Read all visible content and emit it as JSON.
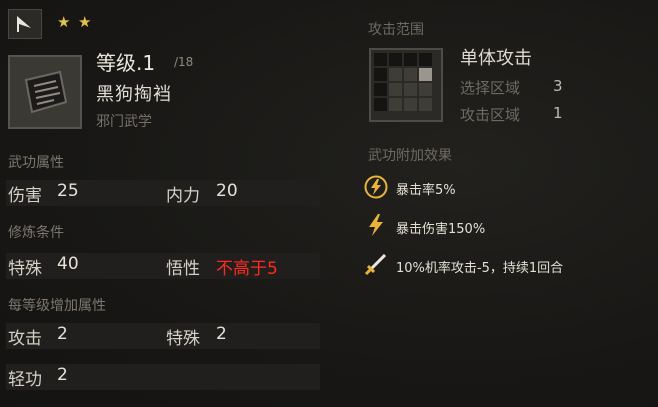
{
  "header": {
    "stars": [
      "★",
      "★"
    ]
  },
  "skill": {
    "level_label": "等级.1",
    "level_max": "/18",
    "name": "黑狗掏裆",
    "school": "邪门武学"
  },
  "attributes": {
    "title": "武功属性",
    "damage_label": "伤害",
    "damage_value": "25",
    "internal_label": "内力",
    "internal_value": "20"
  },
  "requirements": {
    "title": "修炼条件",
    "special_label": "特殊",
    "special_value": "40",
    "comprehension_label": "悟性",
    "comprehension_value": "不高于5"
  },
  "per_level": {
    "title": "每等级增加属性",
    "attack_label": "攻击",
    "attack_value": "2",
    "special_label": "特殊",
    "special_value": "2",
    "agility_label": "轻功",
    "agility_value": "2"
  },
  "attack_range": {
    "title": "攻击范围",
    "target_type": "单体攻击",
    "select_area_label": "选择区域",
    "select_area_value": "3",
    "attack_area_label": "攻击区域",
    "attack_area_value": "1"
  },
  "effects": {
    "title": "武功附加效果",
    "items": [
      {
        "icon": "lightning-circle-icon",
        "text": "暴击率5%"
      },
      {
        "icon": "lightning-icon",
        "text": "暴击伤害150%"
      },
      {
        "icon": "sword-icon",
        "text": "10%机率攻击-5，持续1回合"
      }
    ]
  },
  "colors": {
    "requirement_fail": "#ff2a1e",
    "star": "#e2c14b",
    "effect_icon": "#e8b43a"
  }
}
